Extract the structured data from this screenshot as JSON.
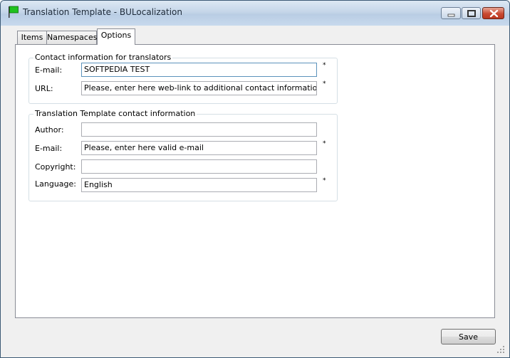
{
  "window": {
    "title": "Translation Template - BULocalization",
    "icon": "green-flag-icon"
  },
  "tabs": [
    {
      "label": "Items",
      "active": false
    },
    {
      "label": "Namespaces",
      "active": false
    },
    {
      "label": "Options",
      "active": true
    }
  ],
  "translators_group": {
    "legend": "Contact information for translators",
    "email_label": "E-mail:",
    "email_value": "SOFTPEDIA TEST",
    "url_label": "URL:",
    "url_value": "Please, enter here web-link to additional contact information for translators"
  },
  "template_group": {
    "legend": "Translation Template contact information",
    "author_label": "Author:",
    "author_value": "",
    "email_label": "E-mail:",
    "email_value": "Please, enter here valid e-mail",
    "copyright_label": "Copyright:",
    "copyright_value": "",
    "language_label": "Language:",
    "language_value": "English"
  },
  "required_marker": "*",
  "footer": {
    "save_label": "Save"
  },
  "colors": {
    "titlebar": "#c5d6e9",
    "close_button": "#c94a32",
    "flag_green": "#1fc21f"
  }
}
